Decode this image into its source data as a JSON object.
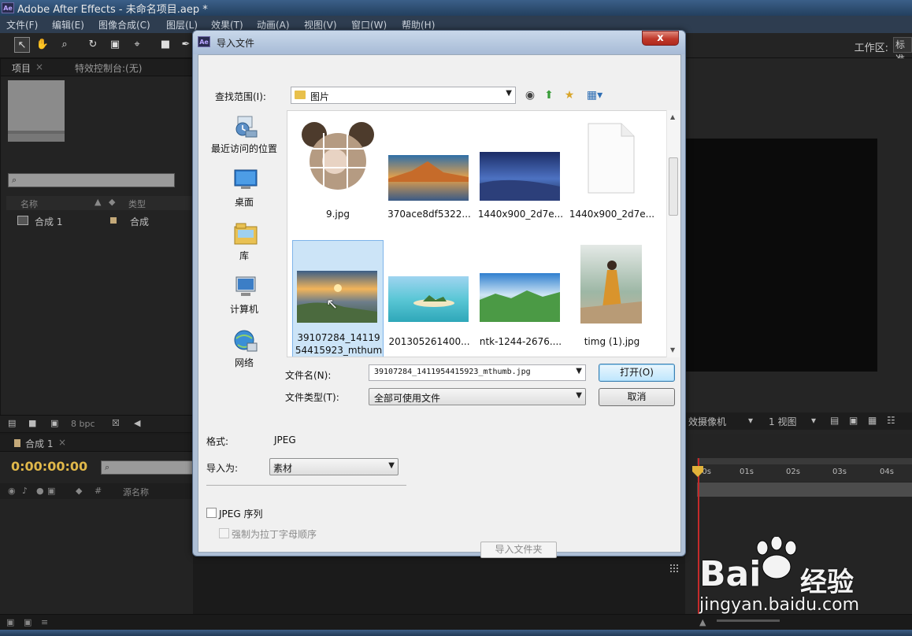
{
  "ae": {
    "title": "Adobe After Effects - 未命名项目.aep *",
    "app_icon": "Ae",
    "menu": [
      "文件(F)",
      "编辑(E)",
      "图像合成(C)",
      "图层(L)",
      "效果(T)",
      "动画(A)",
      "视图(V)",
      "窗口(W)",
      "帮助(H)"
    ],
    "workspace_label": "工作区:",
    "workspace_value": "标准",
    "project_tab": "项目",
    "effect_tab": "特效控制台:(无)",
    "col_name": "名称",
    "col_type": "类型",
    "comp_name": "合成 1",
    "comp_type": "合成",
    "bpc": "8 bpc",
    "timeline_tab": "合成 1",
    "timecode": "0:00:00:00",
    "layer_col": "源名称",
    "ruler": [
      "00s",
      "01s",
      "02s",
      "03s",
      "04s"
    ],
    "view_camera": "效摄像机",
    "view_count": "1 视图",
    "colors": {
      "accent_timecode": "#e0b84a",
      "playhead": "#c42a2a",
      "selection": "#cce4f7"
    }
  },
  "dialog": {
    "title": "导入文件",
    "close_label": "x",
    "look_in_label": "查找范围(I):",
    "look_in_value": "图片",
    "places": [
      {
        "label": "最近访问的位置",
        "icon": "recent-places-icon"
      },
      {
        "label": "桌面",
        "icon": "desktop-icon"
      },
      {
        "label": "库",
        "icon": "libraries-icon"
      },
      {
        "label": "计算机",
        "icon": "computer-icon"
      },
      {
        "label": "网络",
        "icon": "network-icon"
      }
    ],
    "files": [
      {
        "name": "9.jpg"
      },
      {
        "name": "370ace8df5322..."
      },
      {
        "name": "1440x900_2d7e..."
      },
      {
        "name": "1440x900_2d7e..."
      },
      {
        "name": "39107284_14119",
        "name2": "54415923_mthum"
      },
      {
        "name": "201305261400..."
      },
      {
        "name": "ntk-1244-2676...."
      },
      {
        "name": "timg (1).jpg"
      }
    ],
    "filename_label": "文件名(N):",
    "filename_value": "39107284_1411954415923_mthumb.jpg",
    "filetype_label": "文件类型(T):",
    "filetype_value": "全部可使用文件",
    "open_button": "打开(O)",
    "cancel_button": "取消",
    "format_label": "格式:",
    "format_value": "JPEG",
    "import_as_label": "导入为:",
    "import_as_value": "素材",
    "jpeg_sequence": "JPEG 序列",
    "force_alpha": "强制为拉丁字母顺序",
    "import_folder": "导入文件夹"
  },
  "watermark": {
    "brand": "Bai",
    "brand_cn": "经验",
    "url": "jingyan.baidu.com"
  }
}
